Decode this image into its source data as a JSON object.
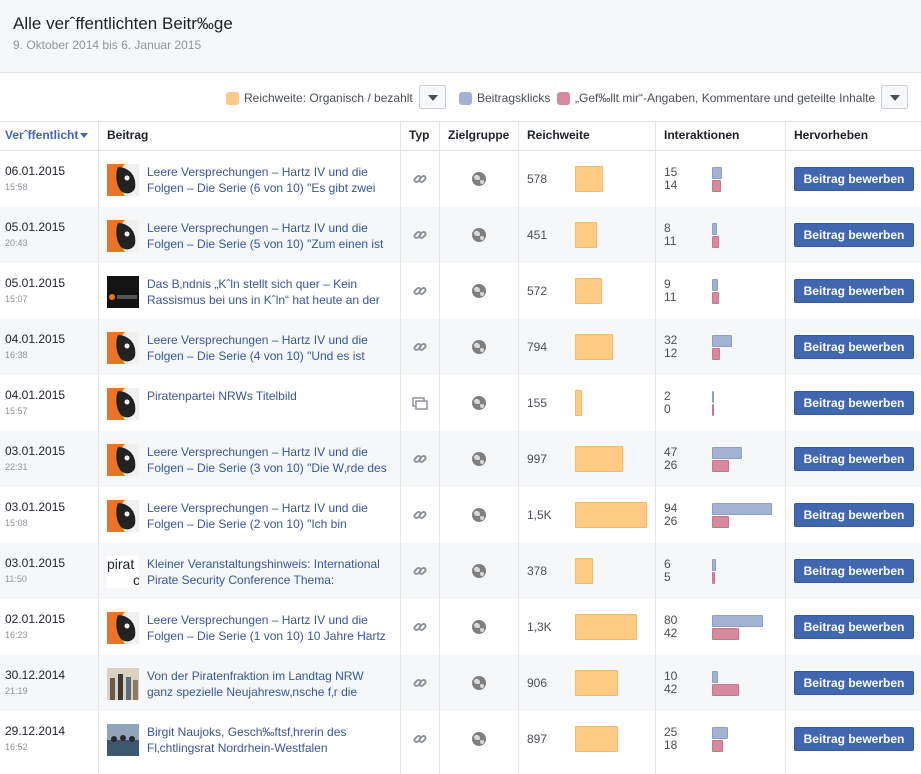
{
  "page": {
    "title": "Alle verˆffentlichten Beitr‰ge",
    "date_range": "9. Oktober 2014 bis 6. Januar 2015"
  },
  "legend": {
    "reach": {
      "label": "Reichweite: Organisch / bezahlt",
      "color": "#ffca83"
    },
    "clicks": {
      "label": "Beitragsklicks",
      "color": "#a2b2d2"
    },
    "likes": {
      "label": "„Gef‰llt mir“-Angaben, Kommentare und geteilte Inhalte",
      "color": "#d7899f"
    }
  },
  "table": {
    "headers": {
      "published": "Verˆffentlicht",
      "post": "Beitrag",
      "type": "Typ",
      "audience": "Zielgruppe",
      "reach": "Reichweite",
      "interactions": "Interaktionen",
      "boost": "Hervorheben"
    },
    "boost_label": "Beitrag bewerben",
    "rows": [
      {
        "date": "06.01.2015",
        "time": "15:58",
        "text": "Leere Versprechungen – Hartz IV und die Folgen – Die Serie (6 von 10) \"Es gibt zwei",
        "thumb": "orange-pirate-icon",
        "type": "link-icon",
        "reach_label": "578",
        "reach": 578,
        "clicks": 15,
        "likes": 14
      },
      {
        "date": "05.01.2015",
        "time": "20:43",
        "text": "Leere Versprechungen – Hartz IV und die Folgen – Die Serie (5 von 10) \"Zum einen ist",
        "thumb": "orange-pirate-icon",
        "type": "link-icon",
        "reach_label": "451",
        "reach": 451,
        "clicks": 8,
        "likes": 11
      },
      {
        "date": "05.01.2015",
        "time": "15:07",
        "text": "Das B‚ndnis „Kˆln stellt sich quer – Kein Rassismus bei uns in Kˆln“ hat heute an der",
        "thumb": "dark-photo",
        "type": "link-icon",
        "reach_label": "572",
        "reach": 572,
        "clicks": 9,
        "likes": 11
      },
      {
        "date": "04.01.2015",
        "time": "16:38",
        "text": "Leere Versprechungen – Hartz IV und die Folgen – Die Serie (4 von 10) \"Und es ist",
        "thumb": "orange-pirate-icon",
        "type": "link-icon",
        "reach_label": "794",
        "reach": 794,
        "clicks": 32,
        "likes": 12
      },
      {
        "date": "04.01.2015",
        "time": "15:57",
        "text": "Piratenpartei NRWs Titelbild",
        "thumb": "orange-pirate-icon",
        "type": "photo-album-icon",
        "reach_label": "155",
        "reach": 155,
        "clicks": 2,
        "likes": 0
      },
      {
        "date": "03.01.2015",
        "time": "22:31",
        "text": "Leere Versprechungen – Hartz IV und die Folgen – Die Serie (3 von 10) \"Die W‚rde des",
        "thumb": "orange-pirate-icon",
        "type": "link-icon",
        "reach_label": "997",
        "reach": 997,
        "clicks": 47,
        "likes": 26
      },
      {
        "date": "03.01.2015",
        "time": "15:08",
        "text": "Leere Versprechungen – Hartz IV und die Folgen – Die Serie (2 von 10) \"Ich bin",
        "thumb": "orange-pirate-icon",
        "type": "link-icon",
        "reach_label": "1,5K",
        "reach": 1500,
        "clicks": 94,
        "likes": 26
      },
      {
        "date": "03.01.2015",
        "time": "11:50",
        "text": "Kleiner Veranstaltungshinweis: International Pirate Security Conference Thema:",
        "thumb": "pirate-text-logo",
        "thumb_text": "pirat",
        "type": "link-icon",
        "reach_label": "378",
        "reach": 378,
        "clicks": 6,
        "likes": 5
      },
      {
        "date": "02.01.2015",
        "time": "16:23",
        "text": "Leere Versprechungen – Hartz IV und die Folgen – Die Serie (1 von 10) 10 Jahre Hartz",
        "thumb": "orange-pirate-icon",
        "type": "link-icon",
        "reach_label": "1,3K",
        "reach": 1300,
        "clicks": 80,
        "likes": 42
      },
      {
        "date": "30.12.2014",
        "time": "21:19",
        "text": "Von der Piratenfraktion im Landtag NRW ganz spezielle Neujahresw‚nsche f‚r die",
        "thumb": "group-photo",
        "type": "link-icon",
        "reach_label": "906",
        "reach": 906,
        "clicks": 10,
        "likes": 42
      },
      {
        "date": "29.12.2014",
        "time": "16:52",
        "text": "Birgit Naujoks, Gesch‰ftsf‚hrerin des Fl‚chtlingsrat Nordrhein-Westfalen",
        "thumb": "meeting-photo",
        "type": "link-icon",
        "reach_label": "897",
        "reach": 897,
        "clicks": 25,
        "likes": 18
      }
    ]
  }
}
